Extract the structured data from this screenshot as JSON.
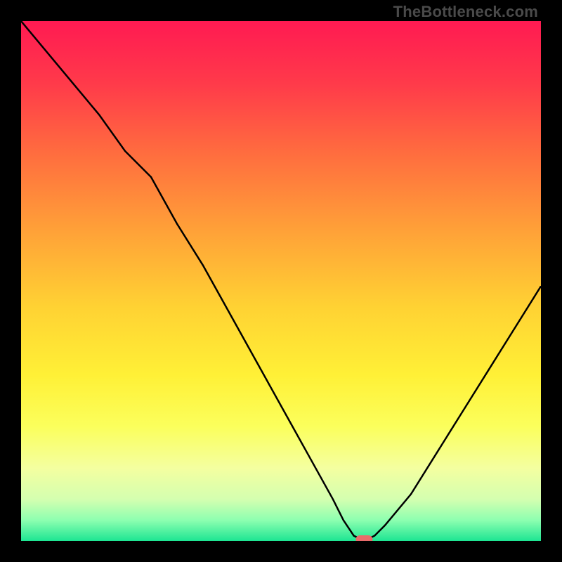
{
  "watermark": "TheBottleneck.com",
  "chart_data": {
    "type": "line",
    "title": "",
    "xlabel": "",
    "ylabel": "",
    "xlim": [
      0,
      100
    ],
    "ylim": [
      0,
      100
    ],
    "grid": false,
    "series": [
      {
        "name": "bottleneck-curve",
        "x": [
          0,
          5,
          10,
          15,
          20,
          25,
          30,
          35,
          40,
          45,
          50,
          55,
          60,
          62,
          64,
          66,
          68,
          70,
          75,
          80,
          85,
          90,
          95,
          100
        ],
        "values": [
          100,
          94,
          88,
          82,
          75,
          70,
          61,
          53,
          44,
          35,
          26,
          17,
          8,
          4,
          1,
          0,
          1,
          3,
          9,
          17,
          25,
          33,
          41,
          49
        ]
      }
    ],
    "marker": {
      "x": 66,
      "y": 0
    },
    "gradient_stops": [
      {
        "offset": 0.0,
        "color": "#ff1a52"
      },
      {
        "offset": 0.12,
        "color": "#ff3a4a"
      },
      {
        "offset": 0.25,
        "color": "#ff6b3f"
      },
      {
        "offset": 0.4,
        "color": "#ffa038"
      },
      {
        "offset": 0.55,
        "color": "#ffd233"
      },
      {
        "offset": 0.68,
        "color": "#fff036"
      },
      {
        "offset": 0.78,
        "color": "#fbff5c"
      },
      {
        "offset": 0.86,
        "color": "#f4ffa0"
      },
      {
        "offset": 0.92,
        "color": "#d4ffb0"
      },
      {
        "offset": 0.96,
        "color": "#8dffb0"
      },
      {
        "offset": 1.0,
        "color": "#1de593"
      }
    ]
  }
}
